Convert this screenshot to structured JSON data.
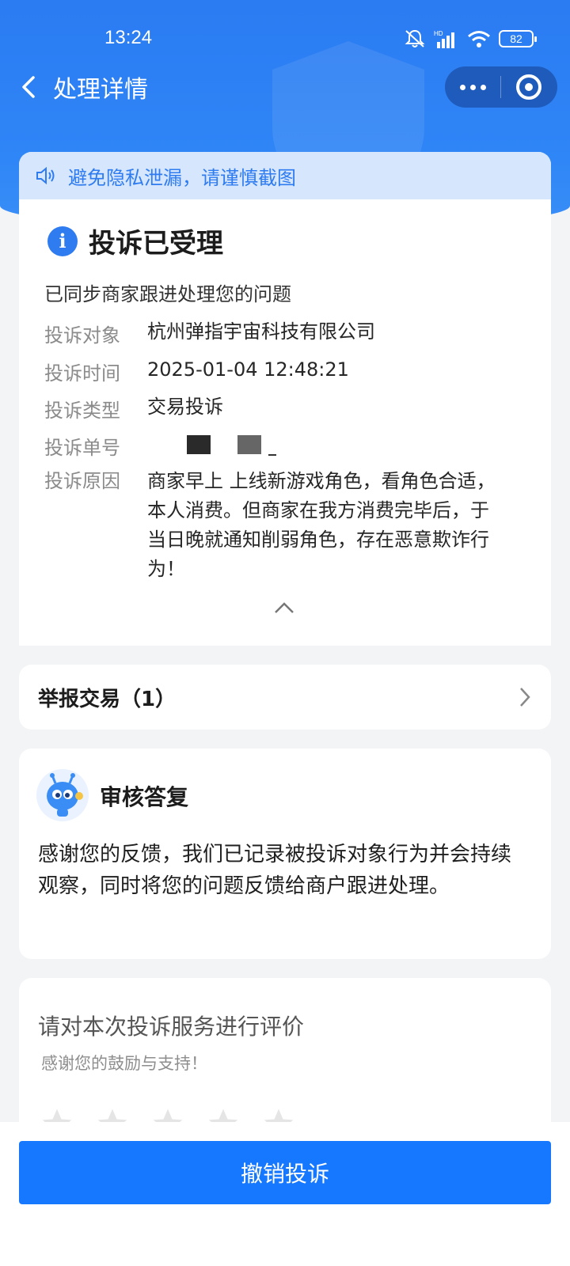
{
  "status_bar": {
    "time": "13:24",
    "battery": "82"
  },
  "nav": {
    "title": "处理详情"
  },
  "privacy_notice": "避免隐私泄漏，请谨慎截图",
  "complaint": {
    "status_title": "投诉已受理",
    "sync_text": "已同步商家跟进处理您的问题",
    "fields": [
      {
        "label": "投诉对象",
        "value": "杭州弹指宇宙科技有限公司"
      },
      {
        "label": "投诉时间",
        "value": "2025-01-04 12:48:21"
      },
      {
        "label": "投诉类型",
        "value": "交易投诉"
      },
      {
        "label": "投诉单号",
        "value": ""
      },
      {
        "label": "投诉原因",
        "value": "商家早上 上线新游戏角色，看角色合适，本人消费。但商家在我方消费完毕后，于当日晚就通知削弱角色，存在恶意欺诈行为！"
      }
    ]
  },
  "report": {
    "label": "举报交易（1）"
  },
  "reply": {
    "title": "审核答复",
    "body": "感谢您的反馈，我们已记录被投诉对象行为并会持续观察，同时将您的问题反馈给商户跟进处理。"
  },
  "rating": {
    "title": "请对本次投诉服务进行评价",
    "subtitle": "感谢您的鼓励与支持！",
    "stars": 5
  },
  "actions": {
    "cancel_label": "撤销投诉"
  },
  "colors": {
    "primary": "#1677ff",
    "header": "#2f86f6",
    "notice_bg": "#d6e6fd"
  },
  "icons": [
    "back-arrow-icon",
    "more-icon",
    "target-icon",
    "speaker-icon",
    "info-icon",
    "chevron-up-icon",
    "chevron-right-icon",
    "mascot-avatar",
    "star-icon"
  ]
}
